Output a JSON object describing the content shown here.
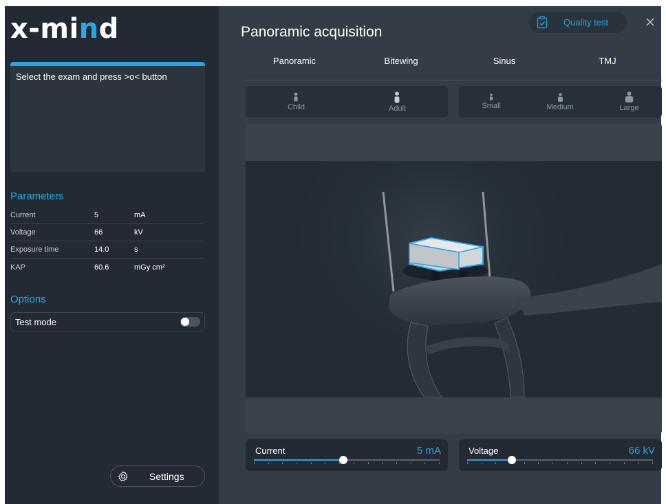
{
  "logo": {
    "part1": "x-mi",
    "part2": "n",
    "part3": "d"
  },
  "instruction": "Select the exam and press >o< button",
  "parameters": {
    "title": "Parameters",
    "rows": [
      {
        "name": "Current",
        "value": "5",
        "unit": "mA"
      },
      {
        "name": "Voltage",
        "value": "66",
        "unit": "kV"
      },
      {
        "name": "Exposure time",
        "value": "14.0",
        "unit": "s"
      },
      {
        "name": "KAP",
        "value": "60.6",
        "unit": "mGy cm²"
      }
    ]
  },
  "options": {
    "title": "Options",
    "test_mode_label": "Test mode",
    "test_mode_on": false
  },
  "settings_label": "Settings",
  "main": {
    "title": "Panoramic acquisition",
    "quality_test_label": "Quality test",
    "tabs": [
      {
        "label": "Panoramic",
        "selected": true
      },
      {
        "label": "Bitewing",
        "selected": false
      },
      {
        "label": "Sinus",
        "selected": false
      },
      {
        "label": "TMJ",
        "selected": false
      }
    ],
    "age_options": [
      {
        "label": "Child"
      },
      {
        "label": "Adult"
      }
    ],
    "size_options": [
      {
        "label": "Small"
      },
      {
        "label": "Medium"
      },
      {
        "label": "Large"
      }
    ]
  },
  "sliders": {
    "current": {
      "label": "Current",
      "value_text": "5 mA",
      "fraction": 0.48
    },
    "voltage": {
      "label": "Voltage",
      "value_text": "66 kV",
      "fraction": 0.24
    }
  },
  "colors": {
    "accent": "#2aa3e6",
    "left_bg": "#232a33",
    "right_bg": "#333c47"
  },
  "icons": {
    "settings": "gear-icon",
    "quality_test": "clipboard-check-icon",
    "close": "close-icon",
    "patient": "person-icon"
  }
}
